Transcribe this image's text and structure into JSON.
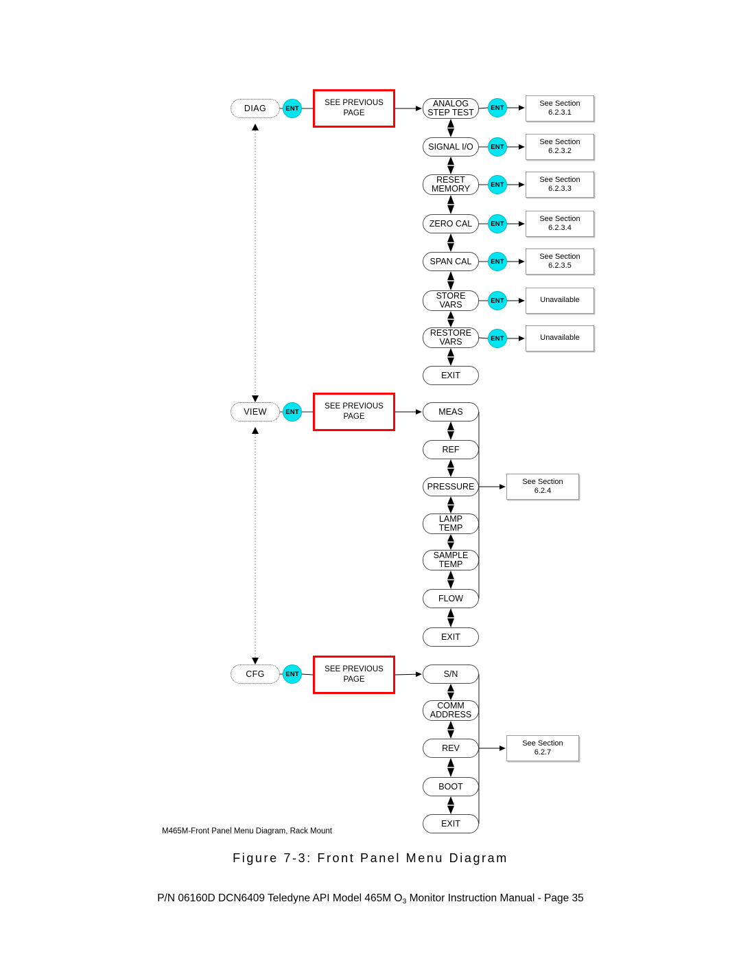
{
  "document": {
    "figure_note": "M465M-Front Panel Menu Diagram, Rack Mount",
    "figure_caption": "Figure 7-3:  Front Panel Menu Diagram",
    "footer_prefix": "P/N 06160D DCN6409 Teledyne API Model 465M O",
    "footer_subscript": "3",
    "footer_suffix": " Monitor Instruction Manual - Page 35"
  },
  "labels": {
    "ent": "ENT",
    "see_previous_page_line1": "SEE PREVIOUS",
    "see_previous_page_line2": "PAGE",
    "see_section": "See Section",
    "unavailable": "Unavailable"
  },
  "colors": {
    "ent_fill": "#00e5f0",
    "prev_box_border": "#ff0000",
    "ref_box_border": "#9a9a9a",
    "node_border": "#4a4a4a",
    "wire": "#000000"
  },
  "branches": [
    {
      "root": "DIAG",
      "section_ref": null,
      "items": [
        {
          "label_1": "ANALOG",
          "label_2": "STEP TEST",
          "ent": true,
          "ref": "See Section",
          "ref_2": "6.2.3.1"
        },
        {
          "label_1": "SIGNAL I/O",
          "label_2": "",
          "ent": true,
          "ref": "See Section",
          "ref_2": "6.2.3.2"
        },
        {
          "label_1": "RESET",
          "label_2": "MEMORY",
          "ent": true,
          "ref": "See Section",
          "ref_2": "6.2.3.3"
        },
        {
          "label_1": "ZERO CAL",
          "label_2": "",
          "ent": true,
          "ref": "See Section",
          "ref_2": "6.2.3.4"
        },
        {
          "label_1": "SPAN CAL",
          "label_2": "",
          "ent": true,
          "ref": "See Section",
          "ref_2": "6.2.3.5"
        },
        {
          "label_1": "STORE",
          "label_2": "VARS",
          "ent": true,
          "ref": "Unavailable",
          "ref_2": ""
        },
        {
          "label_1": "RESTORE",
          "label_2": "VARS",
          "ent": true,
          "ref": "Unavailable",
          "ref_2": ""
        },
        {
          "label_1": "EXIT",
          "label_2": "",
          "ent": false,
          "ref": null,
          "ref_2": ""
        }
      ]
    },
    {
      "root": "VIEW",
      "section_ref": {
        "line1": "See Section",
        "line2": "6.2.4"
      },
      "items": [
        {
          "label_1": "MEAS",
          "label_2": "",
          "ent": false,
          "ref": null,
          "ref_2": ""
        },
        {
          "label_1": "REF",
          "label_2": "",
          "ent": false,
          "ref": null,
          "ref_2": ""
        },
        {
          "label_1": "PRESSURE",
          "label_2": "",
          "ent": false,
          "ref": null,
          "ref_2": ""
        },
        {
          "label_1": "LAMP",
          "label_2": "TEMP",
          "ent": false,
          "ref": null,
          "ref_2": ""
        },
        {
          "label_1": "SAMPLE",
          "label_2": "TEMP",
          "ent": false,
          "ref": null,
          "ref_2": ""
        },
        {
          "label_1": "FLOW",
          "label_2": "",
          "ent": false,
          "ref": null,
          "ref_2": ""
        },
        {
          "label_1": "EXIT",
          "label_2": "",
          "ent": false,
          "ref": null,
          "ref_2": ""
        }
      ]
    },
    {
      "root": "CFG",
      "section_ref": {
        "line1": "See Section",
        "line2": "6.2.7"
      },
      "items": [
        {
          "label_1": "S/N",
          "label_2": "",
          "ent": false,
          "ref": null,
          "ref_2": ""
        },
        {
          "label_1": "COMM",
          "label_2": "ADDRESS",
          "ent": false,
          "ref": null,
          "ref_2": ""
        },
        {
          "label_1": "REV",
          "label_2": "",
          "ent": false,
          "ref": null,
          "ref_2": ""
        },
        {
          "label_1": "BOOT",
          "label_2": "",
          "ent": false,
          "ref": null,
          "ref_2": ""
        },
        {
          "label_1": "EXIT",
          "label_2": "",
          "ent": false,
          "ref": null,
          "ref_2": ""
        }
      ]
    }
  ]
}
